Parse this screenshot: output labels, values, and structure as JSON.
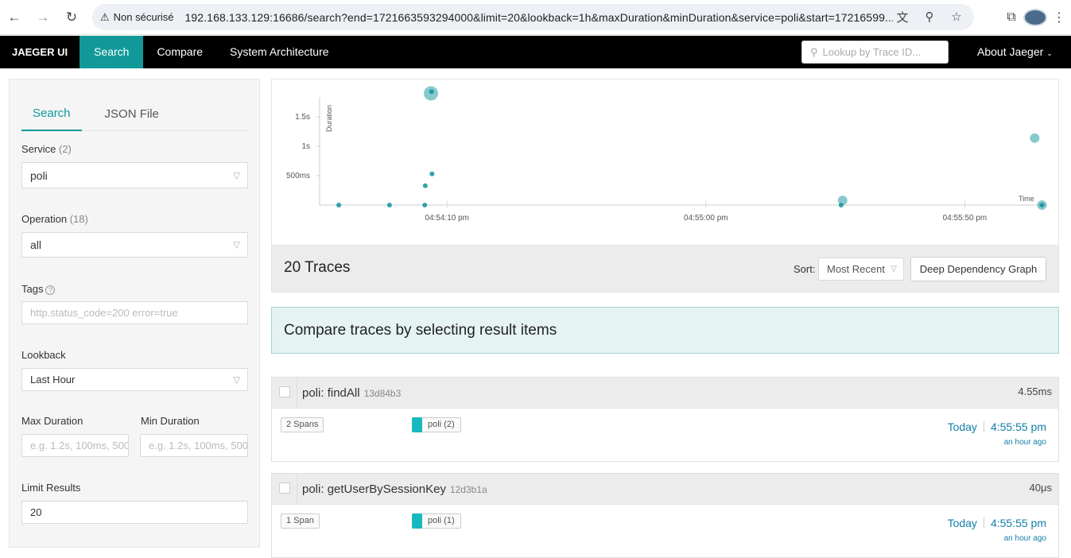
{
  "browser": {
    "security_label": "Non sécurisé",
    "url": "192.168.133.129:16686/search?end=1721663593294000&limit=20&lookback=1h&maxDuration&minDuration&service=poli&start=17216599..."
  },
  "nav": {
    "brand": "JAEGER UI",
    "items": [
      {
        "label": "Search",
        "active": true
      },
      {
        "label": "Compare",
        "active": false
      },
      {
        "label": "System Architecture",
        "active": false
      }
    ],
    "lookup_placeholder": "Lookup by Trace ID...",
    "about": "About Jaeger"
  },
  "search_panel": {
    "tabs": [
      "Search",
      "JSON File"
    ],
    "service": {
      "label": "Service",
      "count": "(2)",
      "value": "poli"
    },
    "operation": {
      "label": "Operation",
      "count": "(18)",
      "value": "all"
    },
    "tags": {
      "label": "Tags",
      "placeholder": "http.status_code=200 error=true"
    },
    "lookback": {
      "label": "Lookback",
      "value": "Last Hour"
    },
    "max_duration": {
      "label": "Max Duration",
      "placeholder": "e.g. 1.2s, 100ms, 500"
    },
    "min_duration": {
      "label": "Min Duration",
      "placeholder": "e.g. 1.2s, 100ms, 500"
    },
    "limit": {
      "label": "Limit Results",
      "value": "20"
    }
  },
  "chart_data": {
    "type": "scatter",
    "xlabel": "Time",
    "ylabel": "Duration",
    "y_ticks": [
      "500ms",
      "1s",
      "1.5s"
    ],
    "x_ticks": [
      "04:54:10 pm",
      "04:55:00 pm",
      "04:55:50 pm"
    ],
    "y_unit": "s",
    "x_unit": "seconds after 04:54:00 pm",
    "xlim": [
      -14.6,
      125.9
    ],
    "ylim": [
      0,
      1.92
    ],
    "points": [
      {
        "x": -10.9,
        "y": 0.0,
        "size": 3
      },
      {
        "x": -1.1,
        "y": 0.0,
        "size": 3
      },
      {
        "x": 5.7,
        "y": 0.0,
        "size": 3
      },
      {
        "x": 5.8,
        "y": 0.33,
        "size": 3
      },
      {
        "x": 7.1,
        "y": 0.53,
        "size": 3
      },
      {
        "x": 6.9,
        "y": 1.9,
        "size": 9
      },
      {
        "x": 7.0,
        "y": 1.93,
        "size": 3
      },
      {
        "x": 86.1,
        "y": 0.0,
        "size": 3
      },
      {
        "x": 86.4,
        "y": 0.08,
        "size": 6
      },
      {
        "x": 123.5,
        "y": 1.14,
        "size": 6
      },
      {
        "x": 124.9,
        "y": 0.0,
        "size": 6
      },
      {
        "x": 124.9,
        "y": 0.0,
        "size": 3
      }
    ]
  },
  "results": {
    "count_label": "20 Traces",
    "sort_label": "Sort:",
    "sort_value": "Most Recent",
    "ddg_button": "Deep Dependency Graph",
    "compare_hint": "Compare traces by selecting result items"
  },
  "traces": [
    {
      "service": "poli",
      "operation": "findAll",
      "id": "13d84b3",
      "duration": "4.55ms",
      "spans": "2 Spans",
      "svc_tag": "poli (2)",
      "day": "Today",
      "time": "4:55:55 pm",
      "ago": "an hour ago"
    },
    {
      "service": "poli",
      "operation": "getUserBySessionKey",
      "id": "12d3b1a",
      "duration": "40μs",
      "spans": "1 Span",
      "svc_tag": "poli (1)",
      "day": "Today",
      "time": "4:55:55 pm",
      "ago": "an hour ago"
    }
  ]
}
